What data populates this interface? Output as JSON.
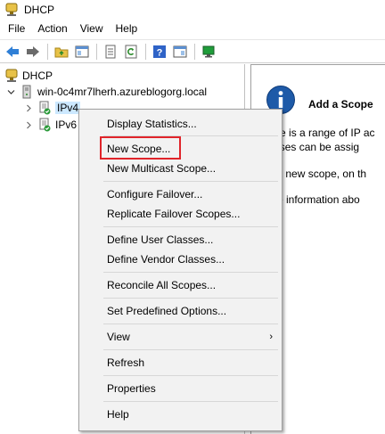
{
  "window": {
    "title": "DHCP",
    "title_icon": "dhcp-icon"
  },
  "menubar": [
    "File",
    "Action",
    "View",
    "Help"
  ],
  "toolbar": {
    "buttons": [
      "back-icon",
      "forward-icon",
      "up-folder-icon",
      "show-hide-tree-icon",
      "export-list-icon",
      "refresh-icon",
      "help-icon",
      "properties-icon",
      "server-icon"
    ]
  },
  "tree": {
    "root": "DHCP",
    "server": "win-0c4mr7lherh.azureblogorg.local",
    "ipv4": "IPv4",
    "ipv6": "IPv6"
  },
  "context_menu": {
    "items": [
      "Display Statistics...",
      "New Scope...",
      "New Multicast Scope...",
      "Configure Failover...",
      "Replicate Failover Scopes...",
      "Define User Classes...",
      "Define Vendor Classes...",
      "Reconcile All Scopes...",
      "Set Predefined Options...",
      "View",
      "Refresh",
      "Properties",
      "Help"
    ],
    "highlighted": "New Scope...",
    "submenu_arrow": "›"
  },
  "info_panel": {
    "title": "Add a Scope",
    "lines": [
      "A scope is a range of IP ac",
      "addresses can be assig",
      "To add a new scope, on th",
      "For more information abo"
    ]
  },
  "colors": {
    "highlight": "#e0242a",
    "selection": "#cce8ff",
    "info_blue": "#1e5aa8"
  }
}
